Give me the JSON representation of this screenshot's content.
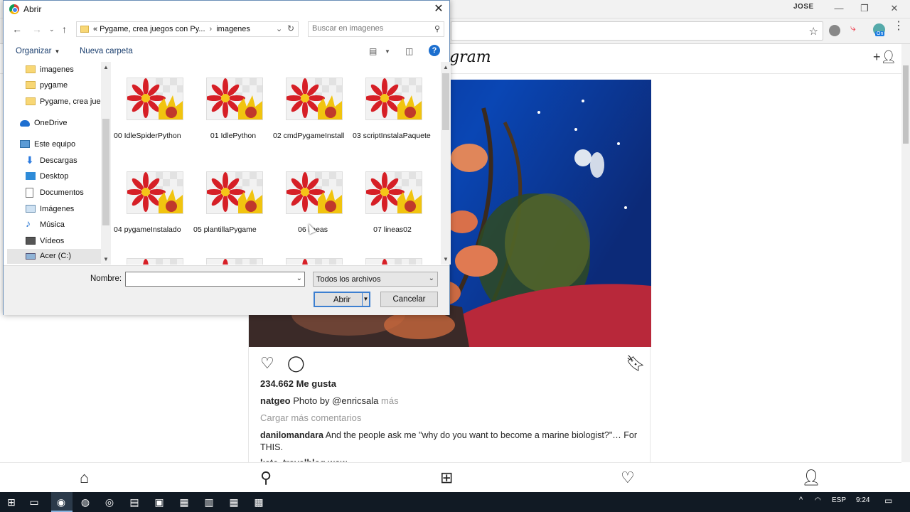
{
  "browser": {
    "user_badge": "JOSE",
    "minimize": "—",
    "restore": "❐",
    "close": "✕",
    "star": "☆",
    "menu": "⋮"
  },
  "instagram": {
    "logo": "gram",
    "post": {
      "likes": "234.662 Me gusta",
      "caption_user": "natgeo",
      "caption_text": " Photo by ",
      "caption_mention": "@enricsala",
      "caption_more": "más",
      "load_more": "Cargar más comentarios",
      "comment_user": "danilomandara",
      "comment_text": " And the people ask me \"why do you want to become a marine biologist?\"… For THIS.",
      "next_comment_user": "kate_travelblog wow"
    }
  },
  "dialog": {
    "title": "Abrir",
    "close": "✕",
    "breadcrumb": [
      "« Pygame, crea juegos con Py...",
      "imagenes"
    ],
    "search_placeholder": "Buscar en imagenes",
    "toolbar": {
      "organize": "Organizar",
      "new_folder": "Nueva carpeta",
      "help": "?"
    },
    "nav_items": [
      {
        "label": "imagenes"
      },
      {
        "label": "pygame"
      },
      {
        "label": "Pygame, crea jue"
      },
      {
        "label": "OneDrive"
      },
      {
        "label": "Este equipo"
      },
      {
        "label": "Descargas"
      },
      {
        "label": "Desktop"
      },
      {
        "label": "Documentos"
      },
      {
        "label": "Imágenes"
      },
      {
        "label": "Música"
      },
      {
        "label": "Vídeos"
      },
      {
        "label": "Acer (C:)"
      }
    ],
    "files": [
      {
        "name": "00 IdleSpiderPython"
      },
      {
        "name": "01 IdlePython"
      },
      {
        "name": "02 cmdPygameInstall"
      },
      {
        "name": "03 scriptInstalaPaquete"
      },
      {
        "name": "04 pygameInstalado"
      },
      {
        "name": "05 plantillaPygame"
      },
      {
        "name": "06 lineas"
      },
      {
        "name": "07 lineas02"
      }
    ],
    "filename_label": "Nombre:",
    "filename_value": "",
    "filter_value": "Todos los archivos",
    "open_button": "Abrir",
    "cancel_button": "Cancelar"
  },
  "taskbar": {
    "language": "ESP",
    "time": "9:24"
  }
}
